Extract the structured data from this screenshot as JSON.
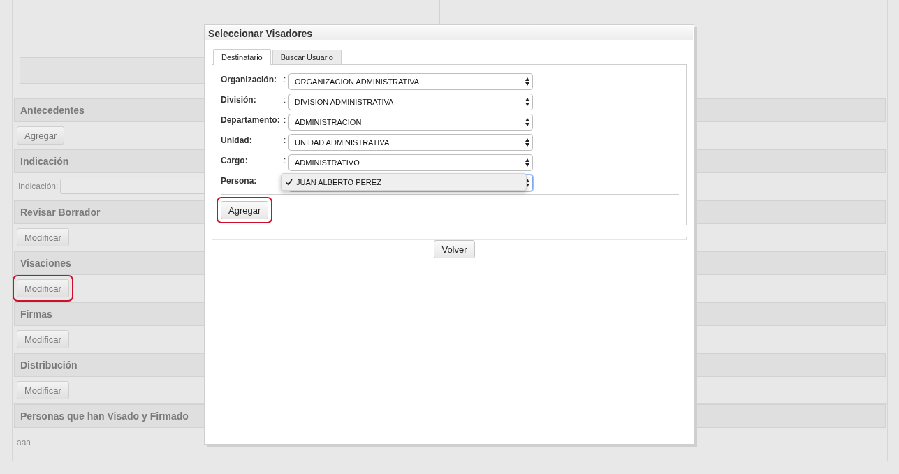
{
  "background_form": {
    "sections": [
      {
        "title": "Antecedentes",
        "kind": "button",
        "button": {
          "label": "Agregar",
          "highlighted": false
        }
      },
      {
        "title": "Indicación",
        "kind": "field",
        "field": {
          "label": "Indicación:"
        }
      },
      {
        "title": "Revisar Borrador",
        "kind": "button",
        "button": {
          "label": "Modificar",
          "highlighted": false
        }
      },
      {
        "title": "Visaciones",
        "kind": "button",
        "button": {
          "label": "Modificar",
          "highlighted": true
        }
      },
      {
        "title": "Firmas",
        "kind": "button",
        "button": {
          "label": "Modificar",
          "highlighted": false
        }
      },
      {
        "title": "Distribución",
        "kind": "button",
        "button": {
          "label": "Modificar",
          "highlighted": false
        }
      },
      {
        "title": "Personas que han Visado y Firmado",
        "kind": "text",
        "text": "aaa"
      }
    ]
  },
  "dialog": {
    "title": "Seleccionar Visadores",
    "tabs": [
      {
        "label": "Destinatario",
        "selected": true
      },
      {
        "label": "Buscar Usuario",
        "selected": false
      }
    ],
    "fields": [
      {
        "label": "Organización:",
        "separator": ":",
        "value": "ORGANIZACION ADMINISTRATIVA"
      },
      {
        "label": "División:",
        "separator": ":",
        "value": "DIVISION ADMINISTRATIVA"
      },
      {
        "label": "Departamento:",
        "separator": ":",
        "value": "ADMINISTRACION"
      },
      {
        "label": "Unidad:",
        "separator": ":",
        "value": "UNIDAD ADMINISTRATIVA"
      },
      {
        "label": "Cargo:",
        "separator": ":",
        "value": "ADMINISTRATIVO"
      }
    ],
    "persona": {
      "label": "Persona:",
      "focused": true,
      "open_option": {
        "label": "JUAN ALBERTO PEREZ",
        "checked": true
      }
    },
    "add_button": {
      "label": "Agregar",
      "highlighted": true
    },
    "back_button": {
      "label": "Volver"
    }
  }
}
